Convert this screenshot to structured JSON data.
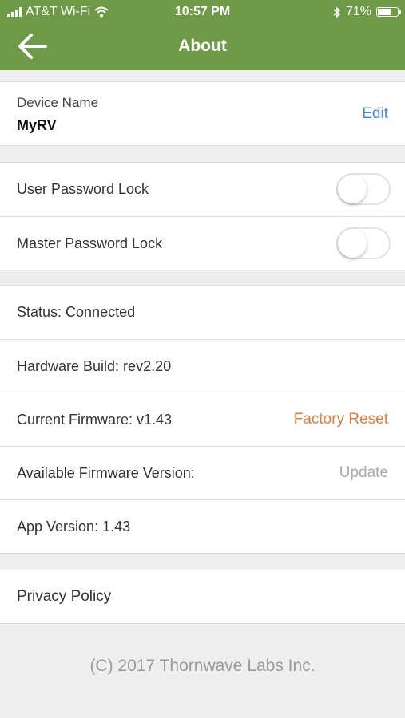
{
  "status_bar": {
    "carrier": "AT&T Wi-Fi",
    "time": "10:57 PM",
    "battery": "71%",
    "battery_level": 0.71
  },
  "header": {
    "title": "About"
  },
  "device": {
    "label": "Device Name",
    "value": "MyRV",
    "edit_label": "Edit"
  },
  "locks": {
    "user_label": "User Password Lock",
    "user_on": false,
    "master_label": "Master Password Lock",
    "master_on": false
  },
  "info": {
    "status": "Status: Connected",
    "hardware": "Hardware Build: rev2.20",
    "firmware": "Current Firmware: v1.43",
    "factory_reset": "Factory Reset",
    "available_firmware": "Available Firmware Version:",
    "update": "Update",
    "app_version": "App Version: 1.43"
  },
  "links": {
    "privacy": "Privacy Policy"
  },
  "footer": {
    "copyright": "(C) 2017 Thornwave Labs Inc."
  },
  "colors": {
    "header_green": "#6e9a47",
    "link_blue": "#4a86d8",
    "reset_orange": "#e07c3c",
    "disabled_grey": "#a8a8a8"
  }
}
